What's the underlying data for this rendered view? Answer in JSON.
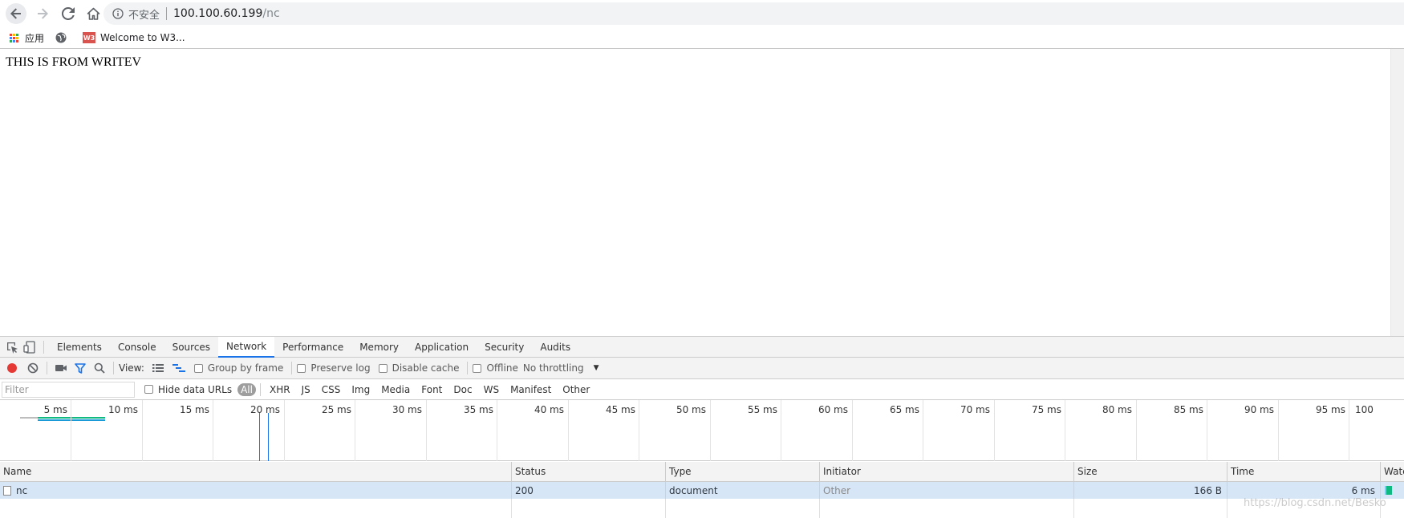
{
  "browser": {
    "security_label": "不安全",
    "url_host": "100.100.60.199",
    "url_path": "/nc",
    "bookmarks": [
      {
        "label": "应用",
        "icon": "apps-grid-icon"
      },
      {
        "label": "",
        "icon": "globe-icon"
      },
      {
        "label": "Welcome to W3...",
        "icon": "w3-favicon-icon"
      }
    ],
    "colors": {
      "toolbar_bg": "#ffffff",
      "omnibox_bg": "#f1f3f4"
    }
  },
  "page": {
    "text": "THIS IS FROM WRITEV"
  },
  "devtools": {
    "tabs": [
      "Elements",
      "Console",
      "Sources",
      "Network",
      "Performance",
      "Memory",
      "Application",
      "Security",
      "Audits"
    ],
    "active_tab": "Network",
    "toolbar": {
      "view_label": "View:",
      "group_by_frame": "Group by frame",
      "preserve_log": "Preserve log",
      "disable_cache": "Disable cache",
      "offline": "Offline",
      "throttling": "No throttling"
    },
    "filter": {
      "placeholder": "Filter",
      "hide_data_urls": "Hide data URLs",
      "types": [
        "All",
        "XHR",
        "JS",
        "CSS",
        "Img",
        "Media",
        "Font",
        "Doc",
        "WS",
        "Manifest",
        "Other"
      ],
      "active_type": "All"
    },
    "timeline_labels": [
      "5 ms",
      "10 ms",
      "15 ms",
      "20 ms",
      "25 ms",
      "30 ms",
      "35 ms",
      "40 ms",
      "45 ms",
      "50 ms",
      "55 ms",
      "60 ms",
      "65 ms",
      "70 ms",
      "75 ms",
      "80 ms",
      "85 ms",
      "90 ms",
      "95 ms",
      "100"
    ],
    "columns": [
      "Name",
      "Status",
      "Type",
      "Initiator",
      "Size",
      "Time",
      "Wate"
    ],
    "requests": [
      {
        "name": "nc",
        "status": "200",
        "type": "document",
        "initiator": "Other",
        "size": "166 B",
        "time": "6 ms"
      }
    ],
    "colors": {
      "record": "#e53935",
      "selected_row": "#d7e6f6",
      "accent": "#1a73e8",
      "dom_loaded_line": "#1a73e8",
      "load_line": "#e53935"
    }
  },
  "watermark": "https://blog.csdn.net/Besko"
}
